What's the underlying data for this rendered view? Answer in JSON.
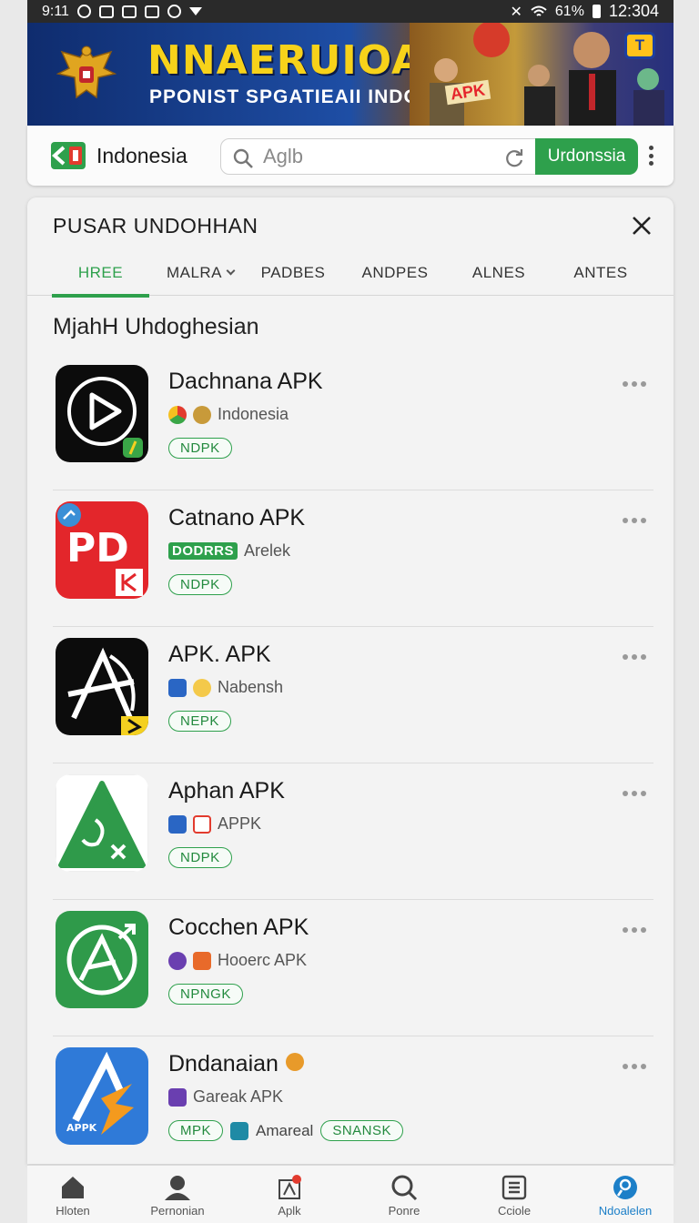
{
  "status_bar": {
    "time": "9:11",
    "battery": "61%",
    "clock": "12:304"
  },
  "banner": {
    "headline": "NNAERUIOAAN",
    "subline": "PPONIST SPGATIEAII INDONEL",
    "apk_badge": "APK",
    "tv_badge": "T"
  },
  "header": {
    "brand": "Indonesia",
    "search_placeholder": "Aglb",
    "search_button": "Urdonssia"
  },
  "panel": {
    "title": "PUSAR UNDOHHAN",
    "tabs": [
      {
        "label": "HREE",
        "active": true
      },
      {
        "label": "MALRA",
        "dropdown": true
      },
      {
        "label": "PADBES"
      },
      {
        "label": "ANDPES"
      },
      {
        "label": "ALNES"
      },
      {
        "label": "ANTES"
      }
    ],
    "section_title": "MjahH Uhdoghesian"
  },
  "apps": [
    {
      "name": "Dachnana APK",
      "meta": "Indonesia",
      "tags": [
        "NDPK"
      ],
      "icon": "play-circle-icon"
    },
    {
      "name": "Catnano APK",
      "developer_badge": "DODRRS",
      "meta": "Arelek",
      "tags": [
        "NDPK"
      ],
      "icon": "pdf-icon"
    },
    {
      "name": "APK. APK",
      "meta": "Nabensh",
      "tags": [
        "NEPK"
      ],
      "icon": "arrow-a-icon"
    },
    {
      "name": "Aphan APK",
      "meta": "APPK",
      "tags": [
        "NDPK"
      ],
      "icon": "triangle-app-icon"
    },
    {
      "name": "Cocchen APK",
      "meta": "Hooerc APK",
      "tags": [
        "NPNGK"
      ],
      "icon": "circle-a-icon"
    },
    {
      "name": "Dndanaian",
      "meta": "Gareak APK",
      "tags": [
        "MPK"
      ],
      "extra_text": "Amareal",
      "extra_tag": "SNANSK",
      "icon": "bolt-a-icon",
      "icon_caption": "APPK"
    }
  ],
  "bottom_nav": [
    {
      "label": "Hloten",
      "icon": "home-icon"
    },
    {
      "label": "Pernonian",
      "icon": "person-icon"
    },
    {
      "label": "Aplk",
      "icon": "apk-icon"
    },
    {
      "label": "Ponre",
      "icon": "search-icon"
    },
    {
      "label": "Cciole",
      "icon": "grid-icon"
    },
    {
      "label": "Ndoalelen",
      "icon": "download-icon",
      "active": true
    }
  ],
  "colors": {
    "accent": "#2ea04c",
    "active_nav": "#1c7fc8",
    "banner_yellow": "#f7d21a"
  }
}
